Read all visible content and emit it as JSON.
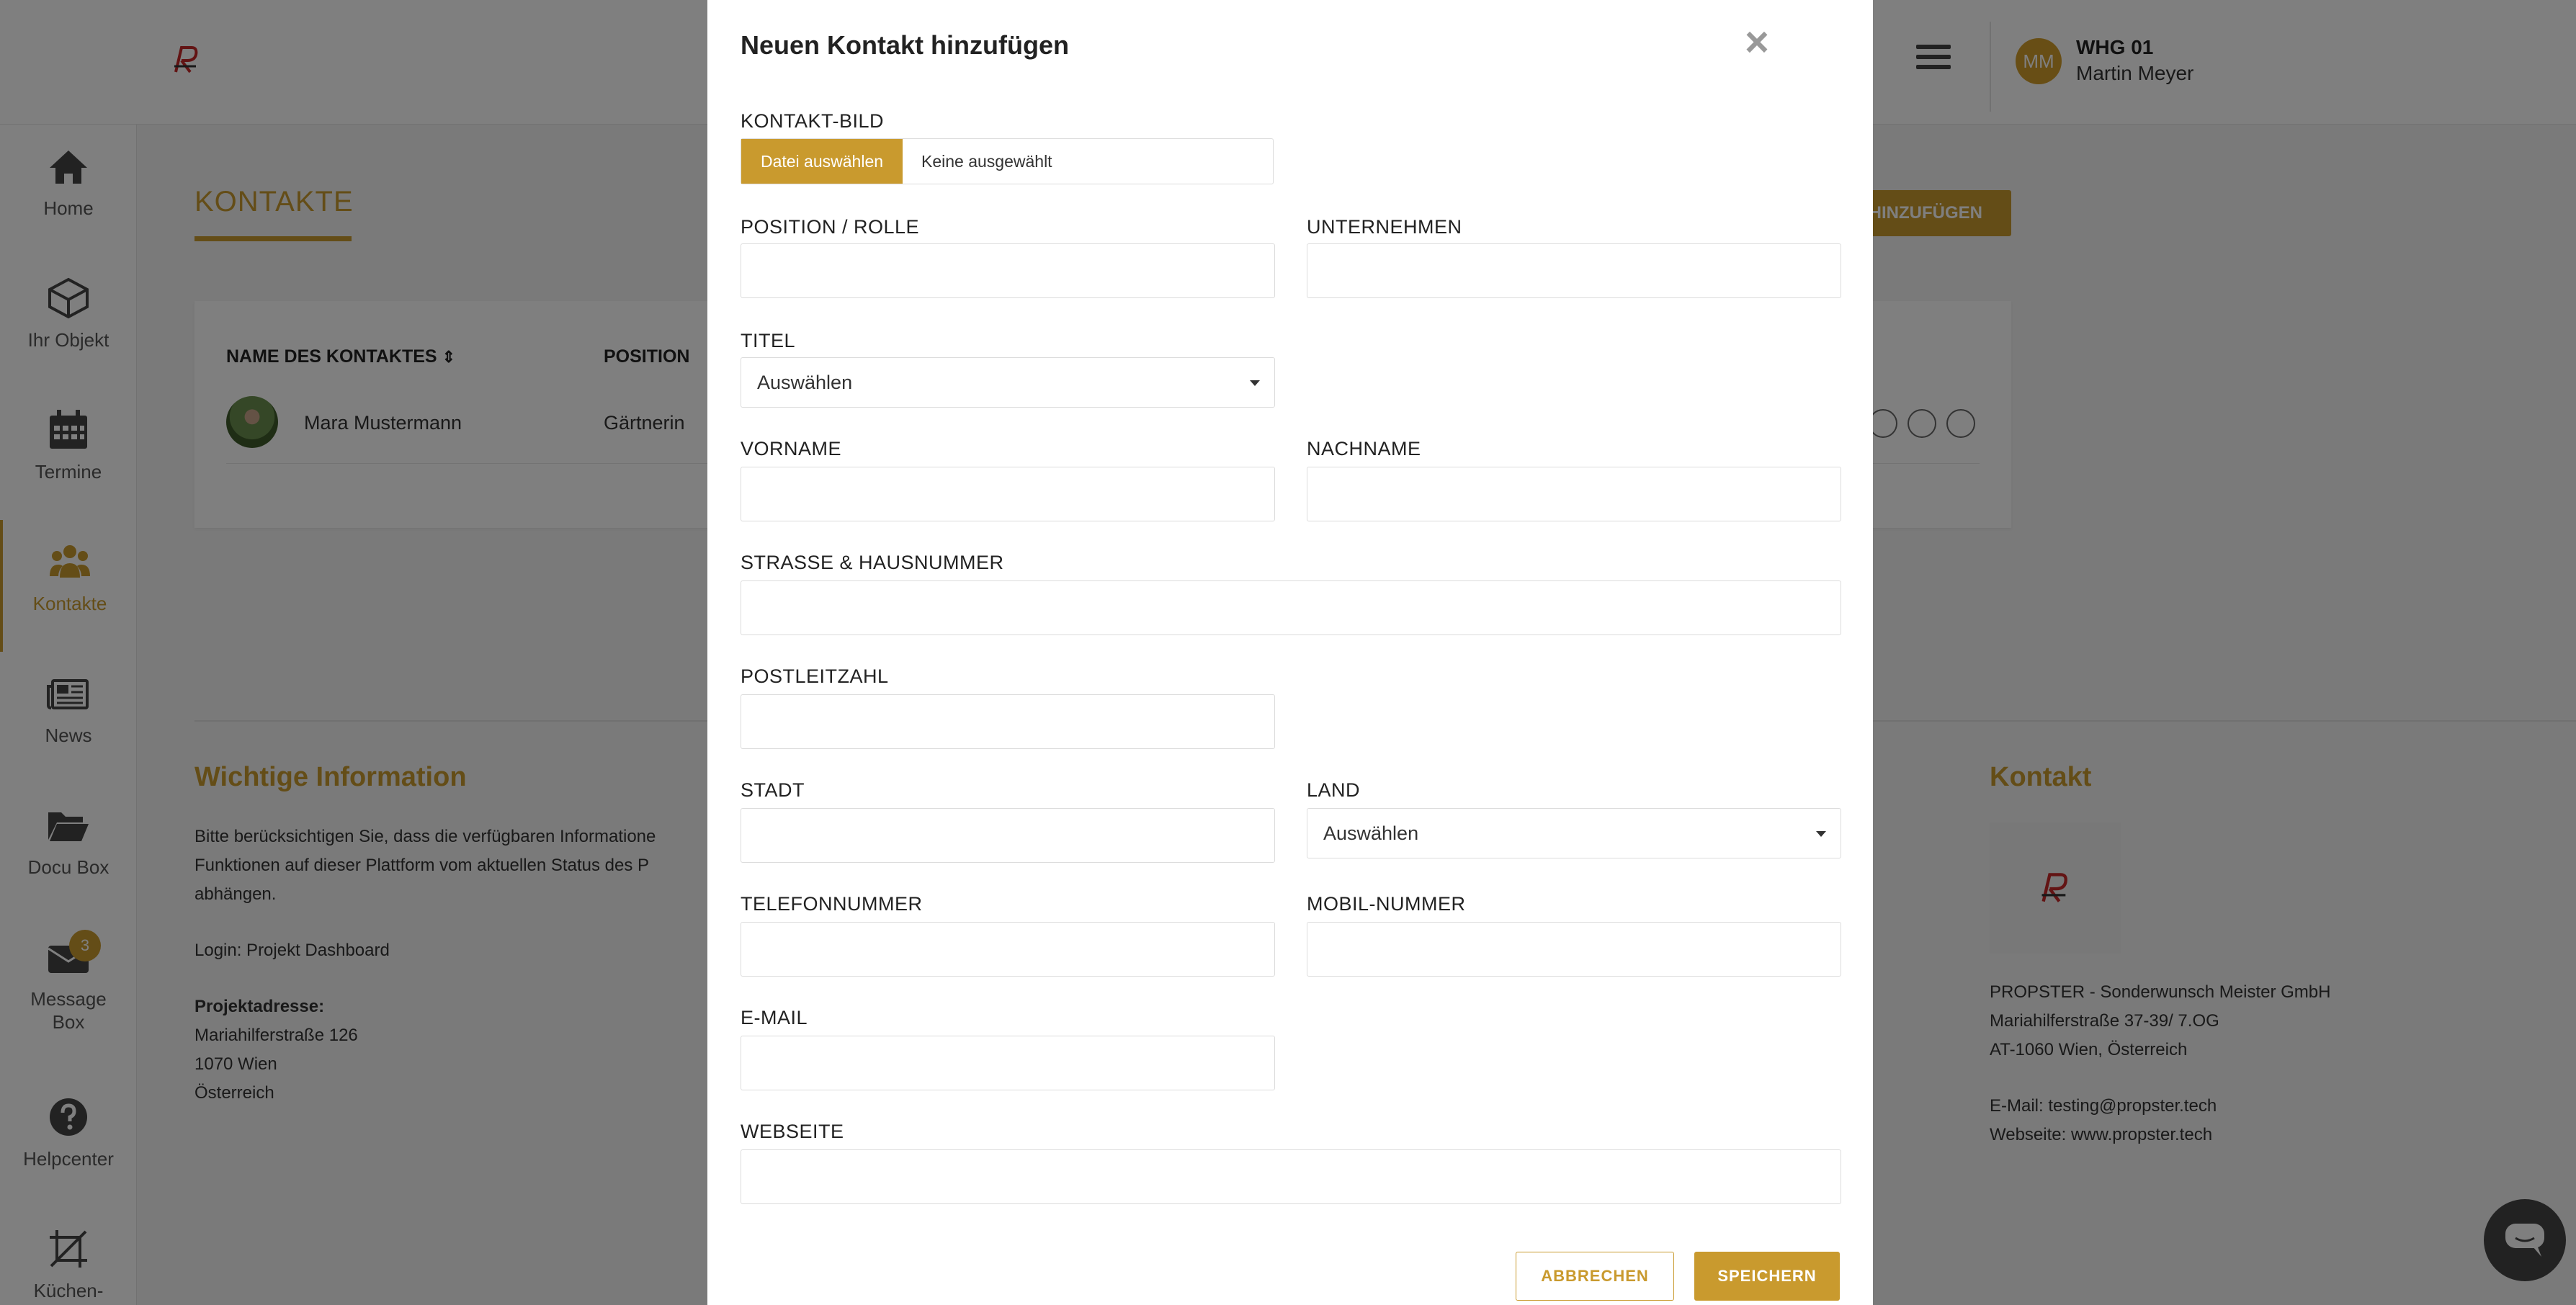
{
  "header": {
    "unit": "WHG 01",
    "user_name": "Martin Meyer",
    "avatar_initials": "MM"
  },
  "sidebar": {
    "items": [
      {
        "label": "Home",
        "icon": "home-icon"
      },
      {
        "label": "Ihr Objekt",
        "icon": "cube-icon"
      },
      {
        "label": "Termine",
        "icon": "calendar-icon"
      },
      {
        "label": "Kontakte",
        "icon": "users-icon",
        "active": true
      },
      {
        "label": "News",
        "icon": "newspaper-icon"
      },
      {
        "label": "Docu Box",
        "icon": "folder-icon"
      },
      {
        "label": "Message Box",
        "icon": "envelope-icon",
        "badge": "3"
      },
      {
        "label": "Helpcenter",
        "icon": "question-icon"
      },
      {
        "label": "Küchen-",
        "icon": "crop-icon"
      }
    ]
  },
  "main": {
    "title": "KONTAKTE",
    "add_button": "HINZUFÜGEN",
    "table": {
      "columns": [
        "NAME DES KONTAKTES",
        "POSITION"
      ],
      "rows": [
        {
          "name": "Mara Mustermann",
          "position": "Gärtnerin"
        }
      ]
    }
  },
  "footer": {
    "info_heading": "Wichtige Information",
    "info_lines": [
      "Bitte berücksichtigen Sie, dass die verfügbaren Informatione",
      "Funktionen auf dieser Plattform vom aktuellen Status des P",
      "abhängen."
    ],
    "login": "Login: Projekt Dashboard",
    "address_label": "Projektadresse:",
    "address_lines": [
      "Mariahilferstraße 126",
      "1070 Wien",
      "Österreich"
    ],
    "contact_heading": "Kontakt",
    "contact_lines": [
      "PROPSTER - Sonderwunsch Meister GmbH",
      "Mariahilferstraße 37-39/ 7.OG",
      "AT-1060 Wien, Österreich"
    ],
    "email": "E-Mail: testing@propster.tech",
    "website": "Webseite: www.propster.tech"
  },
  "modal": {
    "title": "Neuen Kontakt hinzufügen",
    "close": "×",
    "fields": {
      "image_label": "KONTAKT-BILD",
      "file_button": "Datei auswählen",
      "file_status": "Keine ausgewählt",
      "position": "POSITION / ROLLE",
      "company": "UNTERNEHMEN",
      "title": "TITEL",
      "title_select": "Auswählen",
      "firstname": "VORNAME",
      "lastname": "NACHNAME",
      "street": "STRASSE & HAUSNUMMER",
      "zip": "POSTLEITZAHL",
      "city": "STADT",
      "country": "LAND",
      "country_select": "Auswählen",
      "phone": "TELEFONNUMMER",
      "mobile": "MOBIL-NUMMER",
      "email": "E-MAIL",
      "website": "WEBSEITE"
    },
    "cancel": "ABBRECHEN",
    "save": "SPEICHERN"
  },
  "colors": {
    "accent": "#c99a2e",
    "overlay": "rgba(0,0,0,0.5)"
  }
}
